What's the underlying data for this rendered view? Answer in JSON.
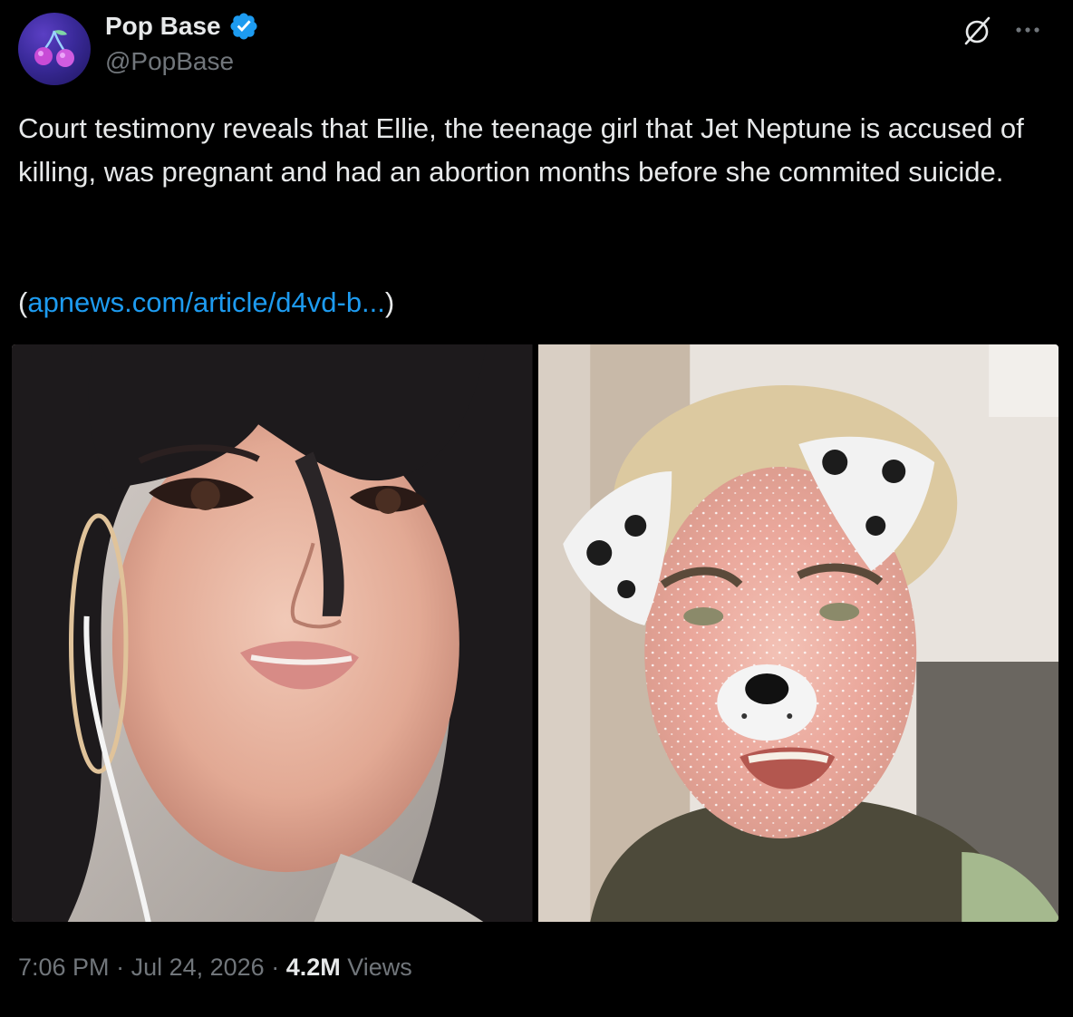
{
  "author": {
    "display_name": "Pop Base",
    "handle": "@PopBase",
    "verified": true,
    "avatar_icon": "cherry-icon"
  },
  "header_actions": {
    "grok_icon": "grok-icon",
    "more_icon": "more-icon"
  },
  "tweet": {
    "text": "Court testimony reveals that Ellie, the teenage girl that Jet Neptune is accused of killing, was pregnant and had an abortion months before she commited suicide.",
    "link_open": "(",
    "link_text": "apnews.com/article/d4vd-b...",
    "link_close": ")"
  },
  "media": [
    {
      "alt_subject": "woman-portrait"
    },
    {
      "alt_subject": "man-dog-filter-selfie"
    }
  ],
  "meta": {
    "time": "7:06 PM",
    "separator1": " · ",
    "date": "Jul 24, 2026",
    "separator2": " · ",
    "views_count": "4.2M",
    "views_label": " Views"
  },
  "colors": {
    "background": "#000000",
    "text_primary": "#e7e9ea",
    "text_secondary": "#71767b",
    "link": "#1d9bf0",
    "verified_badge": "#1d9bf0"
  }
}
